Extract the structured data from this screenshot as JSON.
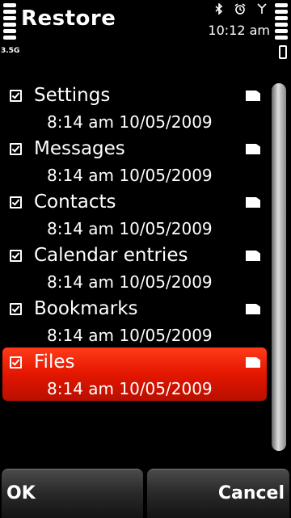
{
  "header": {
    "title": "Restore",
    "network": "3.5G",
    "clock": "10:12 am"
  },
  "status_icons": [
    "bluetooth-icon",
    "alarm-icon",
    "antenna-icon"
  ],
  "items": [
    {
      "name": "Settings",
      "date": "8:14  am 10/05/2009",
      "checked": true,
      "selected": false
    },
    {
      "name": "Messages",
      "date": "8:14  am 10/05/2009",
      "checked": true,
      "selected": false
    },
    {
      "name": "Contacts",
      "date": "8:14  am 10/05/2009",
      "checked": true,
      "selected": false
    },
    {
      "name": "Calendar entries",
      "date": "8:14  am 10/05/2009",
      "checked": true,
      "selected": false
    },
    {
      "name": "Bookmarks",
      "date": "8:14  am 10/05/2009",
      "checked": true,
      "selected": false
    },
    {
      "name": "Files",
      "date": "8:14  am 10/05/2009",
      "checked": true,
      "selected": true
    }
  ],
  "softkeys": {
    "left": "OK",
    "right": "Cancel"
  },
  "colors": {
    "highlight": "#e41600",
    "background": "#000000"
  }
}
